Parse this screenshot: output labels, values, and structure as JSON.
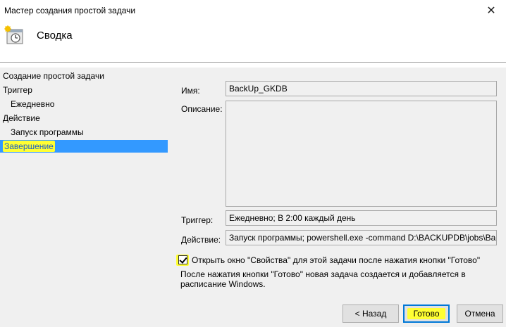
{
  "window": {
    "title": "Мастер создания простой задачи",
    "close_glyph": "✕"
  },
  "header": {
    "title": "Сводка",
    "icon": "task-scheduler-clock-icon"
  },
  "steps": [
    {
      "label": "Создание простой задачи",
      "level": "main"
    },
    {
      "label": "Триггер",
      "level": "main"
    },
    {
      "label": "Ежедневно",
      "level": "sub"
    },
    {
      "label": "Действие",
      "level": "main"
    },
    {
      "label": "Запуск программы",
      "level": "sub"
    },
    {
      "label": "Завершение",
      "level": "main",
      "active": true
    }
  ],
  "summary": {
    "name_label": "Имя:",
    "name_value": "BackUp_GKDB",
    "description_label": "Описание:",
    "description_value": "",
    "trigger_label": "Триггер:",
    "trigger_value": "Ежедневно; В 2:00 каждый день",
    "action_label": "Действие:",
    "action_value": "Запуск программы; powershell.exe -command D:\\BACKUPDB\\jobs\\Backup"
  },
  "options": {
    "open_properties_label": "Открыть окно \"Свойства\" для этой задачи после нажатия кнопки \"Готово\"",
    "open_properties_checked": true,
    "note": "После нажатия кнопки \"Готово\" новая задача создается и добавляется в расписание Windows."
  },
  "buttons": {
    "back": "< Назад",
    "finish": "Готово",
    "cancel": "Отмена"
  },
  "colors": {
    "selection": "#3399ff",
    "highlight": "#ffff33",
    "default_button_border": "#0078d7"
  }
}
